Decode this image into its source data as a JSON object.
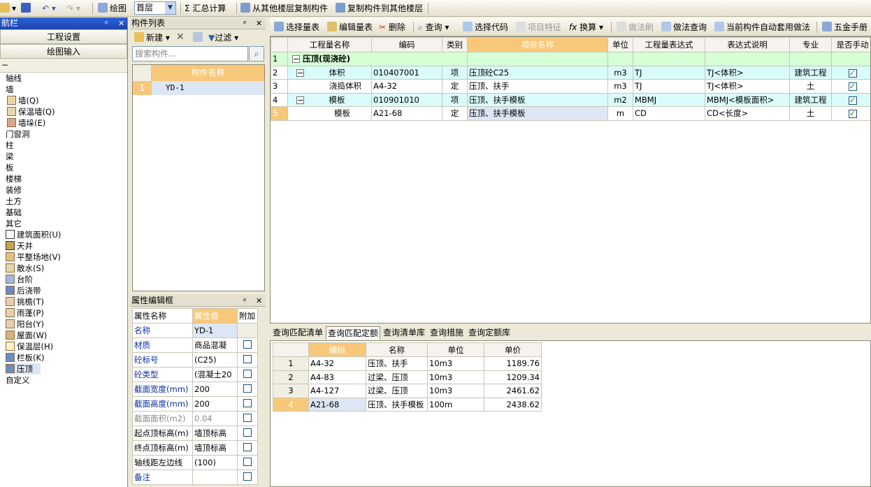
{
  "toolbar": {
    "draw": "绘图",
    "floor": "首层",
    "sum": "汇总计算",
    "copy_from": "从其他楼层复制构件",
    "copy_to": "复制构件到其他楼层"
  },
  "nav": {
    "title": "航栏",
    "project_settings": "工程设置",
    "draw_input": "绘图输入",
    "items": [
      "轴线",
      "墙",
      "墙(Q)",
      "保温墙(Q)",
      "墙垛(E)",
      "门窗洞",
      "柱",
      "梁",
      "板",
      "楼梯",
      "装修",
      "土方",
      "基础",
      "其它",
      "建筑面积(U)",
      "天井",
      "平整场地(V)",
      "散水(S)",
      "台阶",
      "后浇带",
      "挑檐(T)",
      "雨蓬(P)",
      "阳台(Y)",
      "屋面(W)",
      "保温层(H)",
      "栏板(K)",
      "压顶",
      "自定义"
    ]
  },
  "complist": {
    "title": "构件列表",
    "new": "新建",
    "filter": "过滤",
    "search_placeholder": "搜索构件...",
    "col_name": "构件名称",
    "rows": [
      {
        "no": "1",
        "name": "YD-1"
      }
    ]
  },
  "props": {
    "title": "属性编辑框",
    "col_name": "属性名称",
    "col_value": "属性值",
    "col_add": "附加",
    "rows": [
      {
        "name": "名称",
        "value": "YD-1"
      },
      {
        "name": "材质",
        "value": "商品混凝"
      },
      {
        "name": "砼标号",
        "value": "(C25)"
      },
      {
        "name": "砼类型",
        "value": "(混凝土20"
      },
      {
        "name": "截面宽度(mm)",
        "value": "200"
      },
      {
        "name": "截面高度(mm)",
        "value": "200"
      },
      {
        "name": "截面面积(m2)",
        "value": "0.04"
      },
      {
        "name": "起点顶标高(m)",
        "value": "墙顶标高"
      },
      {
        "name": "终点顶标高(m)",
        "value": "墙顶标高"
      },
      {
        "name": "轴线距左边线",
        "value": "(100)"
      },
      {
        "name": "备注",
        "value": ""
      }
    ]
  },
  "main_toolbar": {
    "select_list": "选择量表",
    "edit_list": "编辑量表",
    "delete": "删除",
    "query": "查询",
    "select_code": "选择代码",
    "item_feature": "项目特征",
    "convert": "换算",
    "method_brush": "做法刷",
    "method_query": "做法查询",
    "auto_apply": "当前构件自动套用做法",
    "hardware": "五金手册"
  },
  "qty_table": {
    "headers": [
      "工程量名称",
      "编码",
      "类别",
      "项目名称",
      "单位",
      "工程量表达式",
      "表达式说明",
      "专业",
      "是否手动"
    ],
    "rows": [
      {
        "no": "1",
        "name": "压顶(现浇砼)",
        "code": "",
        "type": "",
        "pname": "",
        "unit": "",
        "expr": "",
        "desc": "",
        "major": "",
        "chk": false
      },
      {
        "no": "2",
        "name": "体积",
        "code": "010407001",
        "type": "项",
        "pname": "压顶砼C25",
        "unit": "m3",
        "expr": "TJ",
        "desc": "TJ<体积>",
        "major": "建筑工程",
        "chk": true
      },
      {
        "no": "3",
        "name": "浇捣体积",
        "code": "A4-32",
        "type": "定",
        "pname": "压顶、扶手",
        "unit": "m3",
        "expr": "TJ",
        "desc": "TJ<体积>",
        "major": "土",
        "chk": true
      },
      {
        "no": "4",
        "name": "模板",
        "code": "010901010",
        "type": "项",
        "pname": "压顶、扶手模板",
        "unit": "m2",
        "expr": "MBMJ",
        "desc": "MBMJ<模板面积>",
        "major": "建筑工程",
        "chk": true
      },
      {
        "no": "5",
        "name": "模板",
        "code": "A21-68",
        "type": "定",
        "pname": "压顶、扶手模板",
        "unit": "m",
        "expr": "CD",
        "desc": "CD<长度>",
        "major": "土",
        "chk": true
      }
    ]
  },
  "bottom_tabs": [
    "查询匹配清单",
    "查询匹配定额",
    "查询清单库",
    "查询措施",
    "查询定额库"
  ],
  "quota_table": {
    "headers": [
      "编码",
      "名称",
      "单位",
      "单价"
    ],
    "rows": [
      {
        "no": "1",
        "code": "A4-32",
        "name": "压顶、扶手",
        "unit": "10m3",
        "price": "1189.76"
      },
      {
        "no": "2",
        "code": "A4-83",
        "name": "过梁、压顶",
        "unit": "10m3",
        "price": "1209.34"
      },
      {
        "no": "3",
        "code": "A4-127",
        "name": "过梁、压顶",
        "unit": "10m3",
        "price": "2461.62"
      },
      {
        "no": "4",
        "code": "A21-68",
        "name": "压顶、扶手模板",
        "unit": "100m",
        "price": "2438.62"
      }
    ]
  }
}
